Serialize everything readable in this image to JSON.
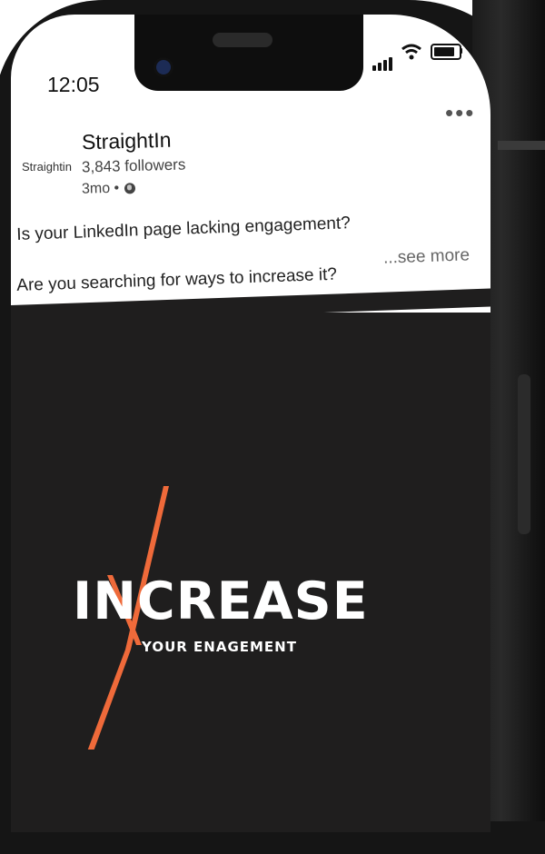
{
  "status_bar": {
    "time": "12:05"
  },
  "post": {
    "company_logo_text": "Straightin",
    "company_name": "StraightIn",
    "followers": "3,843 followers",
    "age": "3mo •",
    "text_line_1": "Is your LinkedIn page lacking engagement?",
    "text_line_2": "Are you searching for ways to increase it?",
    "see_more": "...see more",
    "menu_icon": "more-horizontal-icon"
  },
  "image": {
    "headline": "INCREASE",
    "subhead": "YOUR ENAGEMENT",
    "accent_color": "#ef6a3a"
  }
}
